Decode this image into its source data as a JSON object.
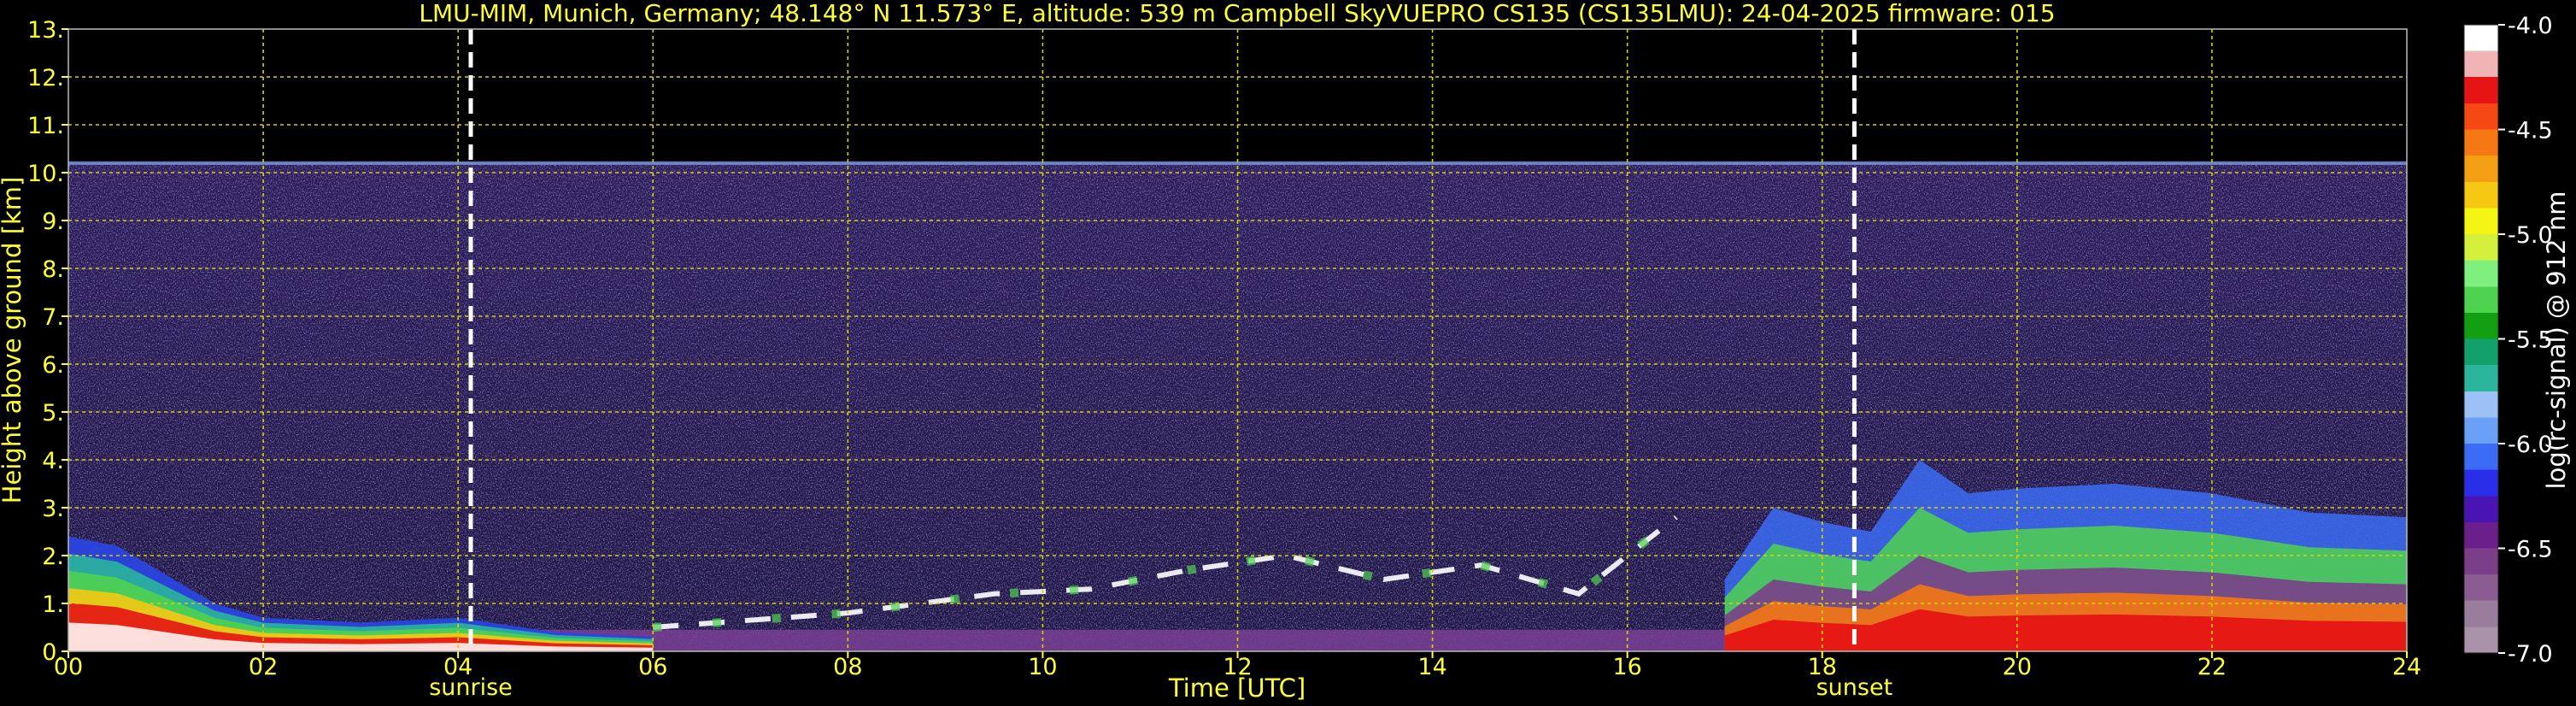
{
  "chart_data": {
    "type": "heatmap",
    "title": "LMU-MIM, Munich, Germany; 48.148° N 11.573° E, altitude: 539 m    Campbell SkyVUEPRO CS135 (CS135LMU): 24-04-2025    firmware: 015",
    "xlabel": "Time [UTC]",
    "ylabel": "Height above ground [km]",
    "xlim": [
      0,
      24
    ],
    "ylim": [
      0,
      13
    ],
    "x_ticks": [
      0,
      2,
      4,
      6,
      8,
      10,
      12,
      14,
      16,
      18,
      20,
      22,
      24
    ],
    "x_tick_labels": [
      "00",
      "02",
      "04",
      "06",
      "08",
      "10",
      "12",
      "14",
      "16",
      "18",
      "20",
      "22",
      "24"
    ],
    "y_ticks": [
      0,
      1,
      2,
      3,
      4,
      5,
      6,
      7,
      8,
      9,
      10,
      11,
      12,
      13
    ],
    "y_tick_labels": [
      "0.",
      "1.",
      "2.",
      "3.",
      "4.",
      "5.",
      "6.",
      "7.",
      "8.",
      "9.",
      "10.",
      "11.",
      "12.",
      "13."
    ],
    "grid": true,
    "events": [
      {
        "label": "sunrise",
        "x": 4.13
      },
      {
        "label": "sunset",
        "x": 18.33
      }
    ],
    "colorbar": {
      "label": "log(rc-signal) @ 912 nm",
      "range": [
        -7.0,
        -4.0
      ],
      "ticks": [
        -7.0,
        -6.5,
        -6.0,
        -5.5,
        -5.0,
        -4.5,
        -4.0
      ],
      "tick_labels": [
        "-7.0",
        "-6.5",
        "-6.0",
        "-5.5",
        "-5.0",
        "-4.5",
        "-4.0"
      ],
      "colors": [
        "#a893a8",
        "#9a7d9c",
        "#8a5c92",
        "#7b3f8a",
        "#6b1f8a",
        "#4a14b5",
        "#2a2ee8",
        "#3c6cf5",
        "#6aa0f5",
        "#9cc2f5",
        "#2ab59c",
        "#14a06a",
        "#12a012",
        "#4fd24f",
        "#7ef07e",
        "#d4f03c",
        "#f5f514",
        "#f5c814",
        "#f5a014",
        "#f57814",
        "#f54814",
        "#e61414",
        "#f0b4b4",
        "#ffffff"
      ]
    },
    "features": [
      {
        "name": "noise_upper_limit_km",
        "value": 10.2
      },
      {
        "name": "boundary_layer_night_top_km",
        "x": [
          0,
          0.5,
          1.0,
          1.5,
          2.0,
          3.0,
          4.0,
          5.0,
          6.0
        ],
        "y": [
          2.4,
          2.2,
          1.6,
          1.0,
          0.7,
          0.6,
          0.7,
          0.4,
          0.3
        ]
      },
      {
        "name": "cloud_layer_km",
        "x": [
          6,
          8,
          9.5,
          10.5,
          11.5,
          12.5,
          13.5,
          14.5,
          15.5,
          16.5
        ],
        "y": [
          0.5,
          0.8,
          1.2,
          1.3,
          1.7,
          2.0,
          1.5,
          1.8,
          1.2,
          2.8
        ]
      },
      {
        "name": "evening_boundary_layer_top_km",
        "x": [
          17.0,
          17.5,
          18.0,
          18.5,
          19.0,
          19.5,
          20.0,
          21.0,
          22.0,
          23.0,
          24.0
        ],
        "y": [
          1.5,
          3.0,
          2.7,
          2.5,
          4.0,
          3.3,
          3.4,
          3.5,
          3.3,
          2.9,
          2.8
        ]
      }
    ]
  }
}
